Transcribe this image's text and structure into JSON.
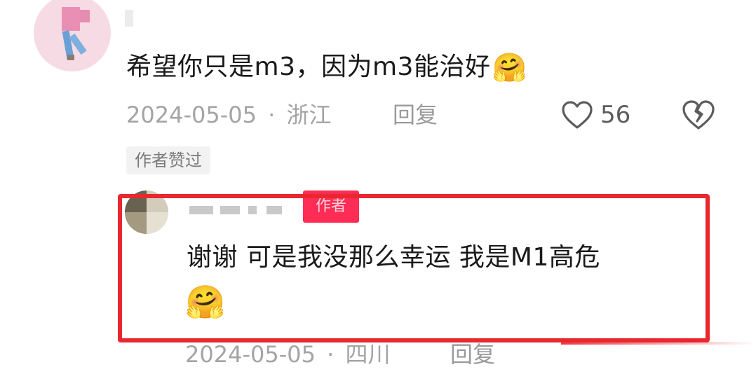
{
  "comment": {
    "text": "希望你只是m3，因为m3能治好",
    "emoji": "🤗",
    "date": "2024-05-05",
    "separator": "·",
    "location": "浙江",
    "reply_label": "回复",
    "like_count": "56",
    "author_liked_badge": "作者赞过"
  },
  "reply": {
    "author_tag": "作者",
    "text": "谢谢  可是我没那么幸运 我是M1高危",
    "emoji": "🤗",
    "date": "2024-05-05",
    "separator": "·",
    "location": "四川",
    "reply_label": "回复"
  },
  "colors": {
    "highlight_border": "#e8272f",
    "author_tag_bg": "#ff2c55",
    "meta_text": "#a4a4a4"
  },
  "icons": {
    "like": "heart-outline-icon",
    "dislike": "broken-heart-icon"
  }
}
